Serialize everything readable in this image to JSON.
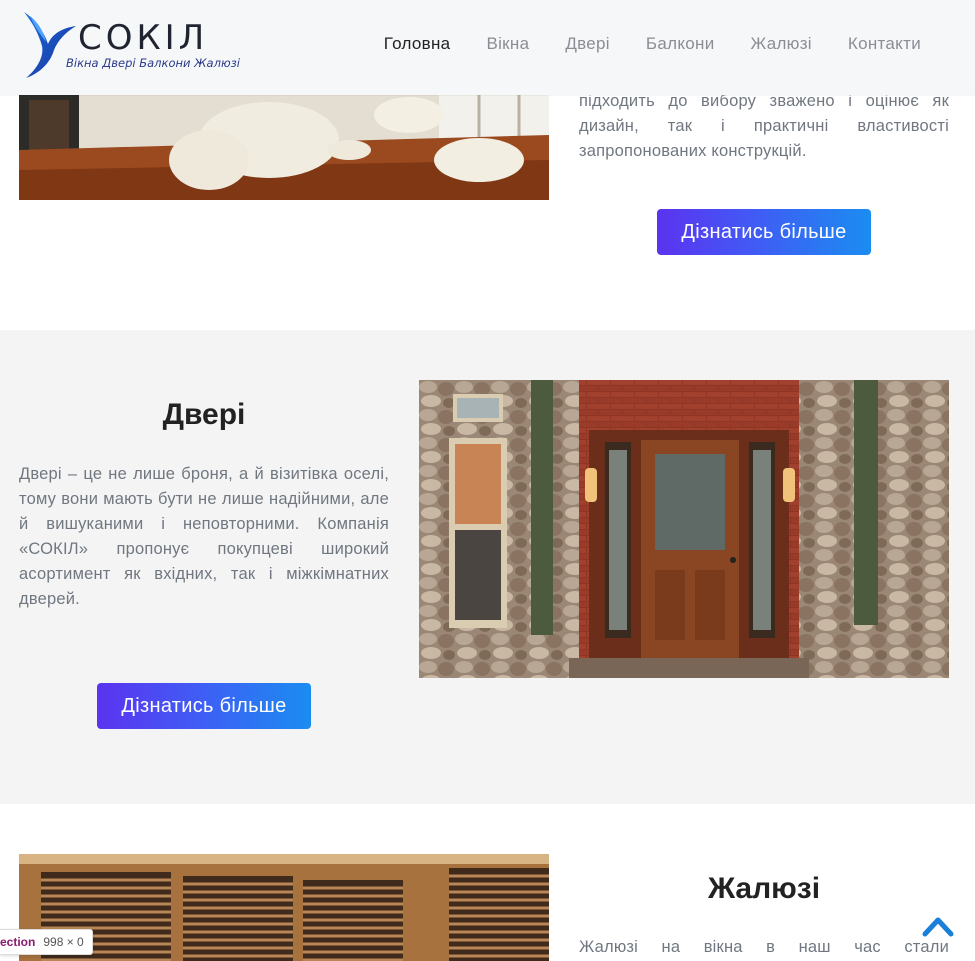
{
  "header": {
    "brand": "СОКІЛ",
    "tagline": "Вікна Двері Балкони Жалюзі",
    "nav": [
      {
        "label": "Головна",
        "active": true
      },
      {
        "label": "Вікна",
        "active": false
      },
      {
        "label": "Двері",
        "active": false
      },
      {
        "label": "Балкони",
        "active": false
      },
      {
        "label": "Жалюзі",
        "active": false
      },
      {
        "label": "Контакти",
        "active": false
      }
    ]
  },
  "section_windows": {
    "text": "підходить до вибору зважено і оцінює як дизайн, так і практичні властивості запропонованих конструкцій.",
    "button": "Дізнатись більше"
  },
  "section_doors": {
    "title": "Двері",
    "text": "Двері – це не лише броня, а й візитівка оселі, тому вони мають бути не лише надійними, але й вишуканими і неповторними. Компанія «СОКІЛ» пропонує покупцеві широкий асортимент як вхідних, так і міжкімнатних дверей.",
    "button": "Дізнатись більше"
  },
  "section_blinds": {
    "title": "Жалюзі",
    "text": "Жалюзі на вікна в наш час стали"
  },
  "devtools_tooltip": {
    "tag": "ection",
    "size": "998 × 0"
  },
  "colors": {
    "accent_start": "#5b33f0",
    "accent_end": "#1a8df0",
    "scroll_icon": "#1a7fd8"
  }
}
